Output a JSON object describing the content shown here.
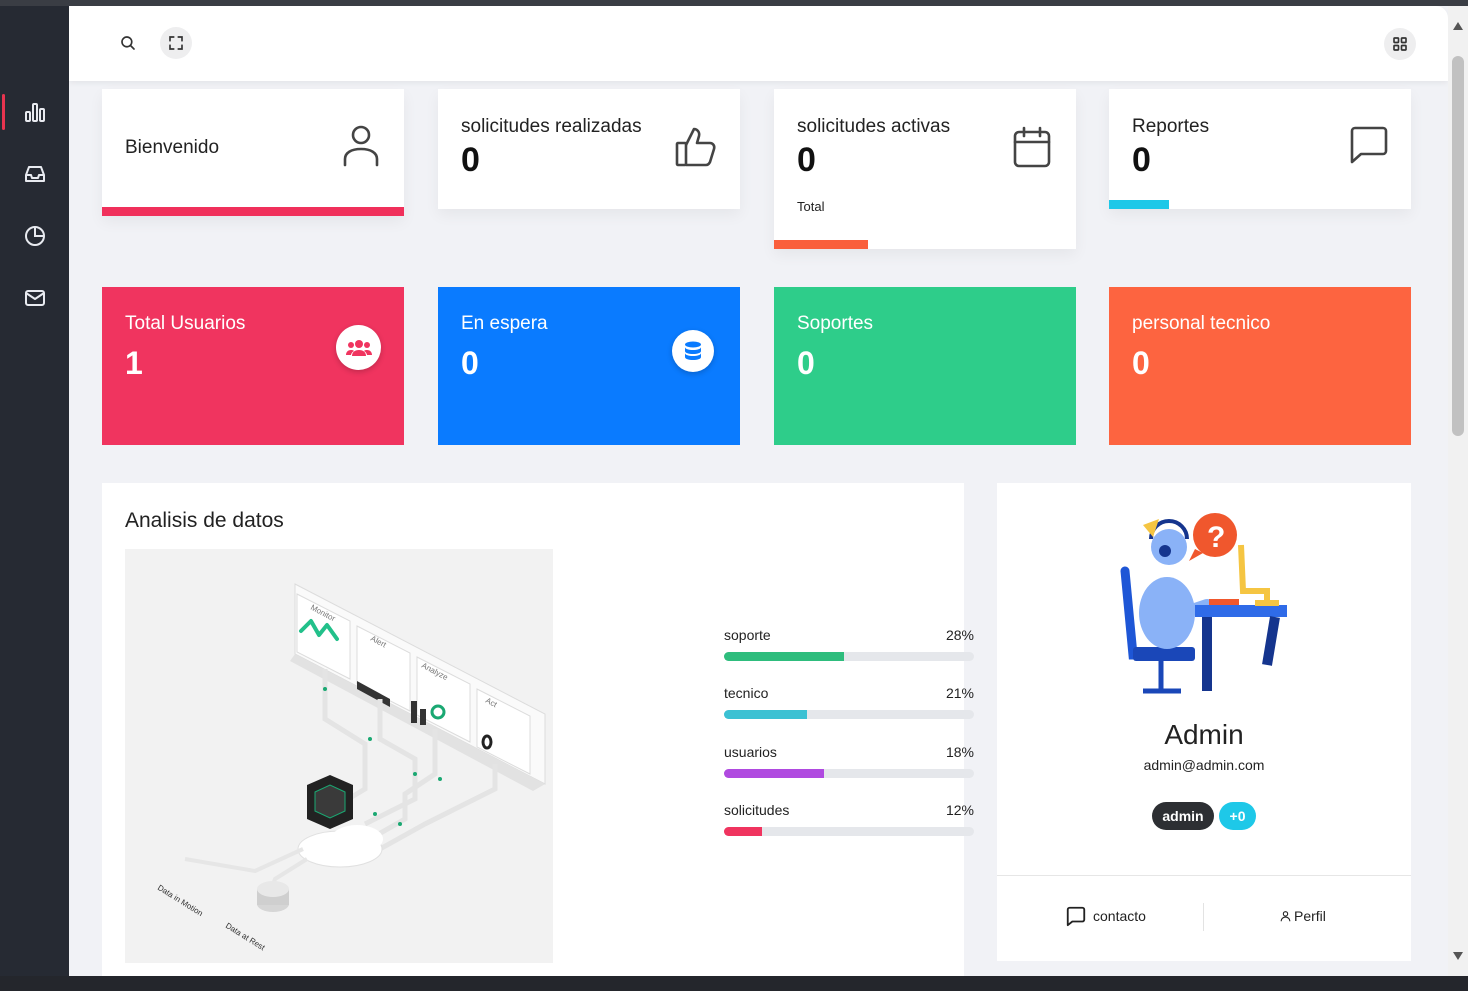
{
  "sidebar": {
    "items": [
      {
        "icon": "bar-chart-icon",
        "active": true
      },
      {
        "icon": "inbox-icon",
        "active": false
      },
      {
        "icon": "pie-chart-icon",
        "active": false
      },
      {
        "icon": "mail-icon",
        "active": false
      }
    ]
  },
  "topbar": {
    "search_icon": "search-icon",
    "fullscreen_icon": "fullscreen-icon",
    "apps_icon": "grid-icon"
  },
  "summary_cards": [
    {
      "title": "Bienvenido",
      "value": "",
      "subtitle": "",
      "icon": "user-icon",
      "bar_color": "#f0305b",
      "bar_fraction": 1.0
    },
    {
      "title": "solicitudes realizadas",
      "value": "0",
      "subtitle": "",
      "icon": "thumbs-up-icon",
      "bar_color": "",
      "bar_fraction": 0
    },
    {
      "title": "solicitudes activas",
      "value": "0",
      "subtitle": "Total",
      "icon": "calendar-icon",
      "bar_color": "#fa5f3c",
      "bar_fraction": 0.31
    },
    {
      "title": "Reportes",
      "value": "0",
      "subtitle": "",
      "icon": "message-icon",
      "bar_color": "#1ec8e8",
      "bar_fraction": 0.2
    }
  ],
  "stat_cards": [
    {
      "title": "Total Usuarios",
      "value": "1",
      "color": "#f0345f",
      "icon": "users-icon",
      "icon_color": "#f0345f"
    },
    {
      "title": "En espera",
      "value": "0",
      "color": "#0a7bff",
      "icon": "database-icon",
      "icon_color": "#0a7bff"
    },
    {
      "title": "Soportes",
      "value": "0",
      "color": "#2ecd8a",
      "icon": "",
      "icon_color": ""
    },
    {
      "title": "personal tecnico",
      "value": "0",
      "color": "#fd6440",
      "icon": "",
      "icon_color": ""
    }
  ],
  "analysis": {
    "title": "Analisis de datos",
    "illustration_labels": [
      "Monitor",
      "Alert",
      "Analyze",
      "Act",
      "Data in Motion",
      "Data at Rest"
    ],
    "progress": [
      {
        "label": "soporte",
        "percent_text": "28%",
        "value": 48,
        "color": "#2ebd7d"
      },
      {
        "label": "tecnico",
        "percent_text": "21%",
        "value": 33,
        "color": "#3bc1d3"
      },
      {
        "label": "usuarios",
        "percent_text": "18%",
        "value": 40,
        "color": "#b04ae0"
      },
      {
        "label": "solicitudes",
        "percent_text": "12%",
        "value": 15,
        "color": "#f0345f"
      }
    ]
  },
  "profile": {
    "name": "Admin",
    "email": "admin@admin.com",
    "badges": [
      {
        "text": "admin",
        "color": "#2d2f33"
      },
      {
        "text": "+0",
        "color": "#1ec8e8"
      }
    ],
    "footer": {
      "contact_label": "contacto",
      "contact_icon": "message-icon",
      "profile_label": "Perfil",
      "profile_icon": "user-icon"
    }
  }
}
